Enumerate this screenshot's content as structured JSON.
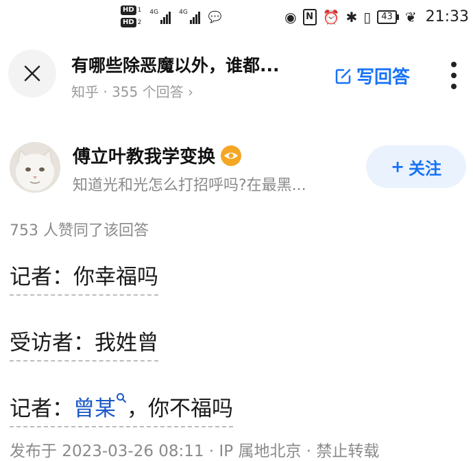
{
  "status_bar": {
    "hd1": "HD",
    "hd1_n": "1",
    "hd2": "HD",
    "hd2_n": "2",
    "signal1_label": "4G",
    "signal2_label": "4G",
    "battery": "43",
    "time": "21:33"
  },
  "header": {
    "question_title": "有哪些除恶魔以外，谁都...",
    "question_subtitle": "知乎 · 355 个回答 ›",
    "write_answer_label": "写回答"
  },
  "author": {
    "name": "傅立叶教我学变换",
    "headline": "知道光和光怎么打招呼吗?在最黑...",
    "follow_label": "关注",
    "follow_prefix": "+"
  },
  "answer": {
    "likes_text": "753 人赞同了该回答",
    "line1": "记者：你幸福吗",
    "line2": "受访者：我姓曾",
    "line3_prefix": "记者：",
    "line3_keyword": "曾某",
    "line3_suffix": "，你不福吗",
    "footer": "发布于 2023-03-26 08:11 · IP 属地北京 · 禁止转载"
  },
  "colors": {
    "accent_blue": "#1772f6",
    "keyword_blue": "#1a57c8",
    "badge_orange": "#f5a623"
  }
}
